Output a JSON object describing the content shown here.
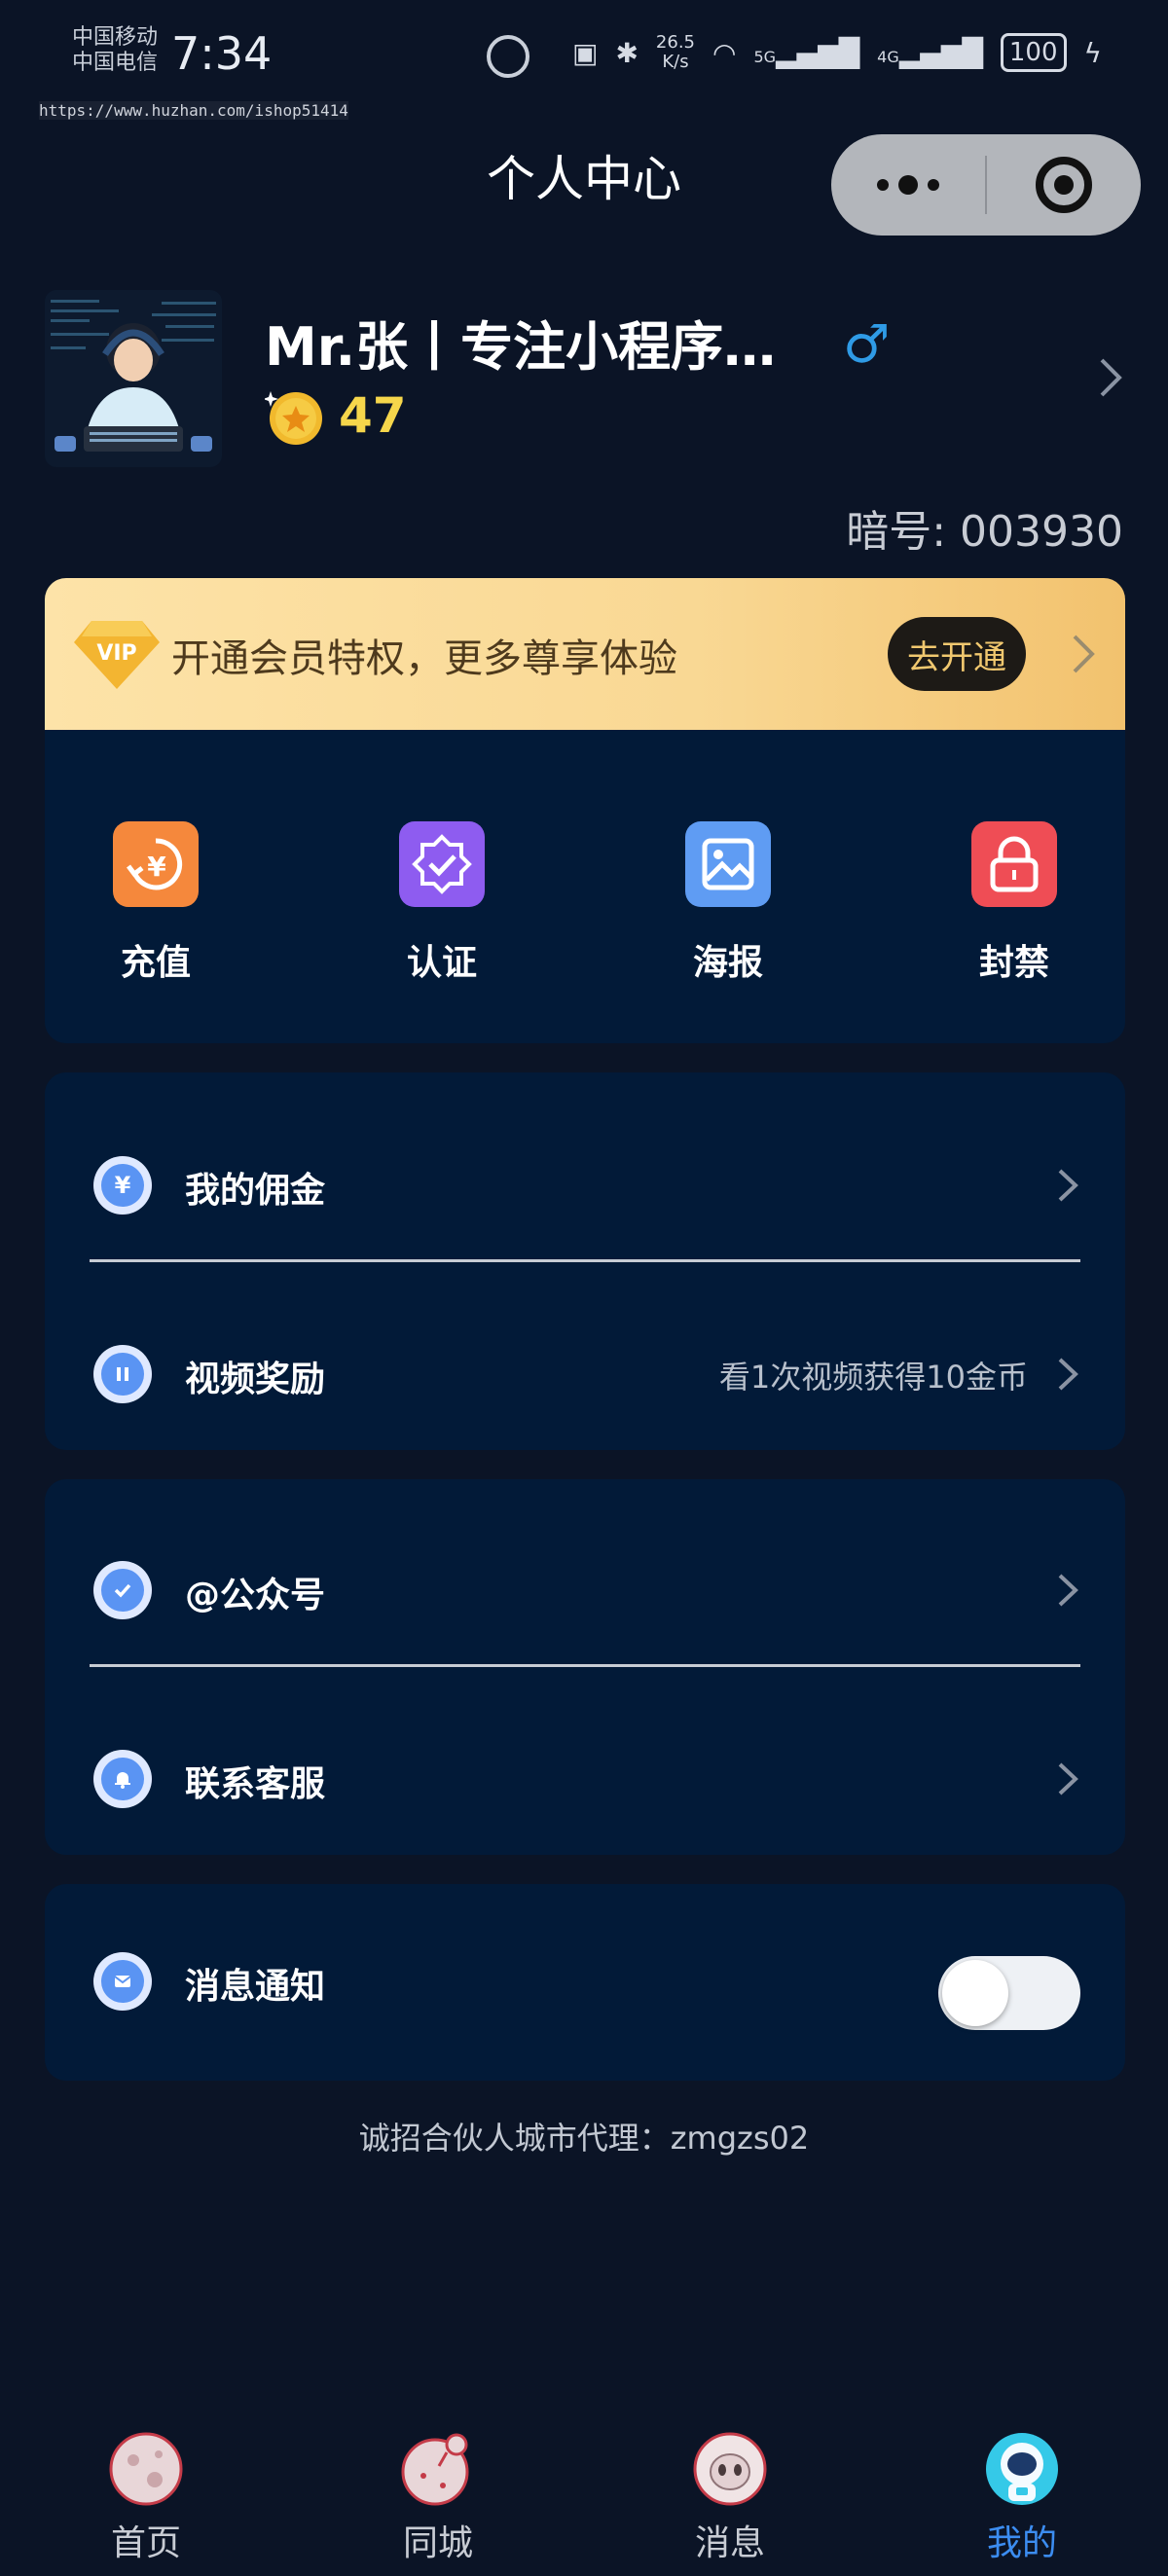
{
  "status_bar": {
    "carrier_1": "中国移动",
    "carrier_2": "中国电信",
    "time": "7:34",
    "speed_value": "26.5",
    "speed_unit": "K/s",
    "signal_1": "5G",
    "signal_2": "4G",
    "battery": "100"
  },
  "watermark_url": "https://www.huzhan.com/ishop51414",
  "header": {
    "title": "个人中心"
  },
  "profile": {
    "username": "Mr.张丨专注小程序…",
    "gender_symbol": "♂",
    "coins": "47",
    "secret_id": "暗号: 003930"
  },
  "vip": {
    "badge": "VIP",
    "text": "开通会员特权，更多尊享体验",
    "button": "去开通"
  },
  "quick_actions": [
    {
      "label": "充值",
      "icon": "recharge-icon",
      "color": "#f5883c"
    },
    {
      "label": "认证",
      "icon": "verify-icon",
      "color": "#8e5cf0"
    },
    {
      "label": "海报",
      "icon": "poster-icon",
      "color": "#5f9cf3"
    },
    {
      "label": "封禁",
      "icon": "ban-icon",
      "color": "#ef4d55"
    }
  ],
  "menu": {
    "commission": {
      "label": "我的佣金",
      "icon_glyph": "¥"
    },
    "video_reward": {
      "label": "视频奖励",
      "extra": "看1次视频获得10金币"
    },
    "official_account": {
      "label": "@公众号"
    },
    "customer_service": {
      "label": "联系客服"
    },
    "notifications": {
      "label": "消息通知",
      "enabled": false
    }
  },
  "recruit_text": "诚招合伙人城市代理：zmgzs02",
  "tabs": [
    {
      "label": "首页",
      "active": false
    },
    {
      "label": "同城",
      "active": false
    },
    {
      "label": "消息",
      "active": false
    },
    {
      "label": "我的",
      "active": true
    }
  ],
  "colors": {
    "background": "#0b1426",
    "card": "#021a38",
    "accent_blue": "#3c8df1",
    "coin_yellow": "#f6d64b",
    "vip_gold": "#f9d894"
  }
}
